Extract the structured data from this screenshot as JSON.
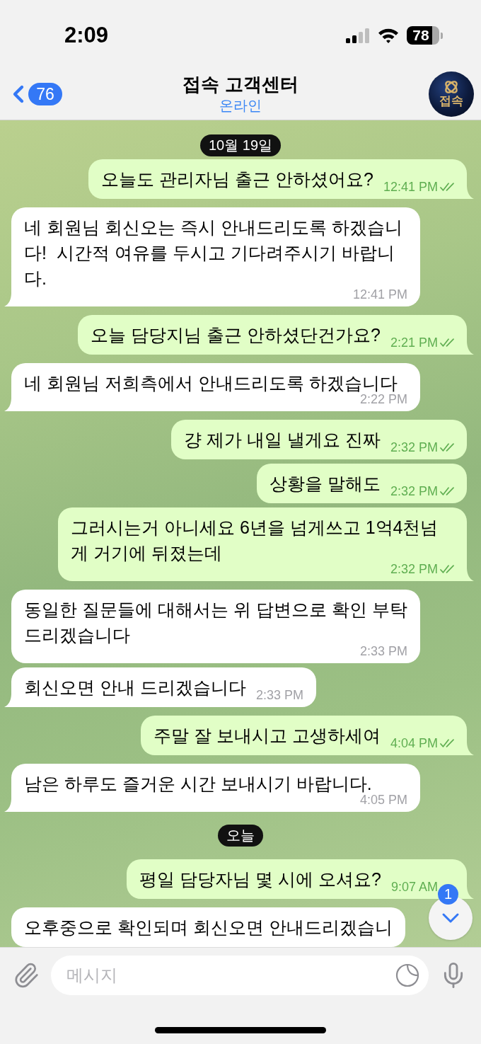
{
  "status_bar": {
    "time": "2:09",
    "battery": "78"
  },
  "header": {
    "back_badge": "76",
    "title": "접속 고객센터",
    "subtitle": "온라인",
    "avatar_label": "접속"
  },
  "chat": {
    "items": [
      {
        "kind": "date",
        "label": "10월 19일"
      },
      {
        "kind": "outgoing",
        "text": "오늘도 관리자님 출근 안하셨어요?",
        "time": "12:41 PM",
        "read": true,
        "tail": true
      },
      {
        "kind": "incoming",
        "text": "네 회원님 회신오는 즉시 안내드리도록 하겠습니다!  시간적 여유를 두시고 기다려주시기 바랍니다.",
        "time": "12:41 PM",
        "tail": true
      },
      {
        "kind": "outgoing",
        "text": "오늘 담당지님 출근 안하셨단건가요?",
        "time": "2:21 PM",
        "read": true,
        "tail": true
      },
      {
        "kind": "incoming",
        "text": "네 회원님 저희측에서 안내드리도록 하겠습니다",
        "time": "2:22 PM",
        "tail": true
      },
      {
        "kind": "outgoing",
        "text": "걍 제가 내일 낼게요 진짜",
        "time": "2:32 PM",
        "read": true,
        "tail": false
      },
      {
        "kind": "outgoing",
        "text": "상황을 말해도",
        "time": "2:32 PM",
        "read": true,
        "tail": false
      },
      {
        "kind": "outgoing",
        "text": "그러시는거 아니세요 6년을 넘게쓰고 1억4천넘게 거기에 뒤졌는데",
        "time": "2:32 PM",
        "read": true,
        "tail": true
      },
      {
        "kind": "incoming",
        "text": "동일한 질문들에 대해서는 위 답변으로 확인 부탁드리겠습니다",
        "time": "2:33 PM",
        "tail": false
      },
      {
        "kind": "incoming",
        "text": "회신오면 안내 드리겠습니다",
        "time": "2:33 PM",
        "tail": true
      },
      {
        "kind": "outgoing",
        "text": "주말 잘 보내시고 고생하세여",
        "time": "4:04 PM",
        "read": true,
        "tail": true
      },
      {
        "kind": "incoming",
        "text": "남은 하루도 즐거운 시간 보내시기 바랍니다.",
        "time": "4:05 PM",
        "tail": true
      },
      {
        "kind": "date",
        "label": "오늘"
      },
      {
        "kind": "outgoing",
        "text": "평일 담당자님 몇 시에 오셔요?",
        "time": "9:07 AM",
        "tail": true
      },
      {
        "kind": "incoming",
        "text": "오후중으로 확인되며 회신오면 안내드리겠습니"
      }
    ]
  },
  "scroll_button": {
    "badge": "1"
  },
  "composer": {
    "placeholder": "메시지"
  }
}
